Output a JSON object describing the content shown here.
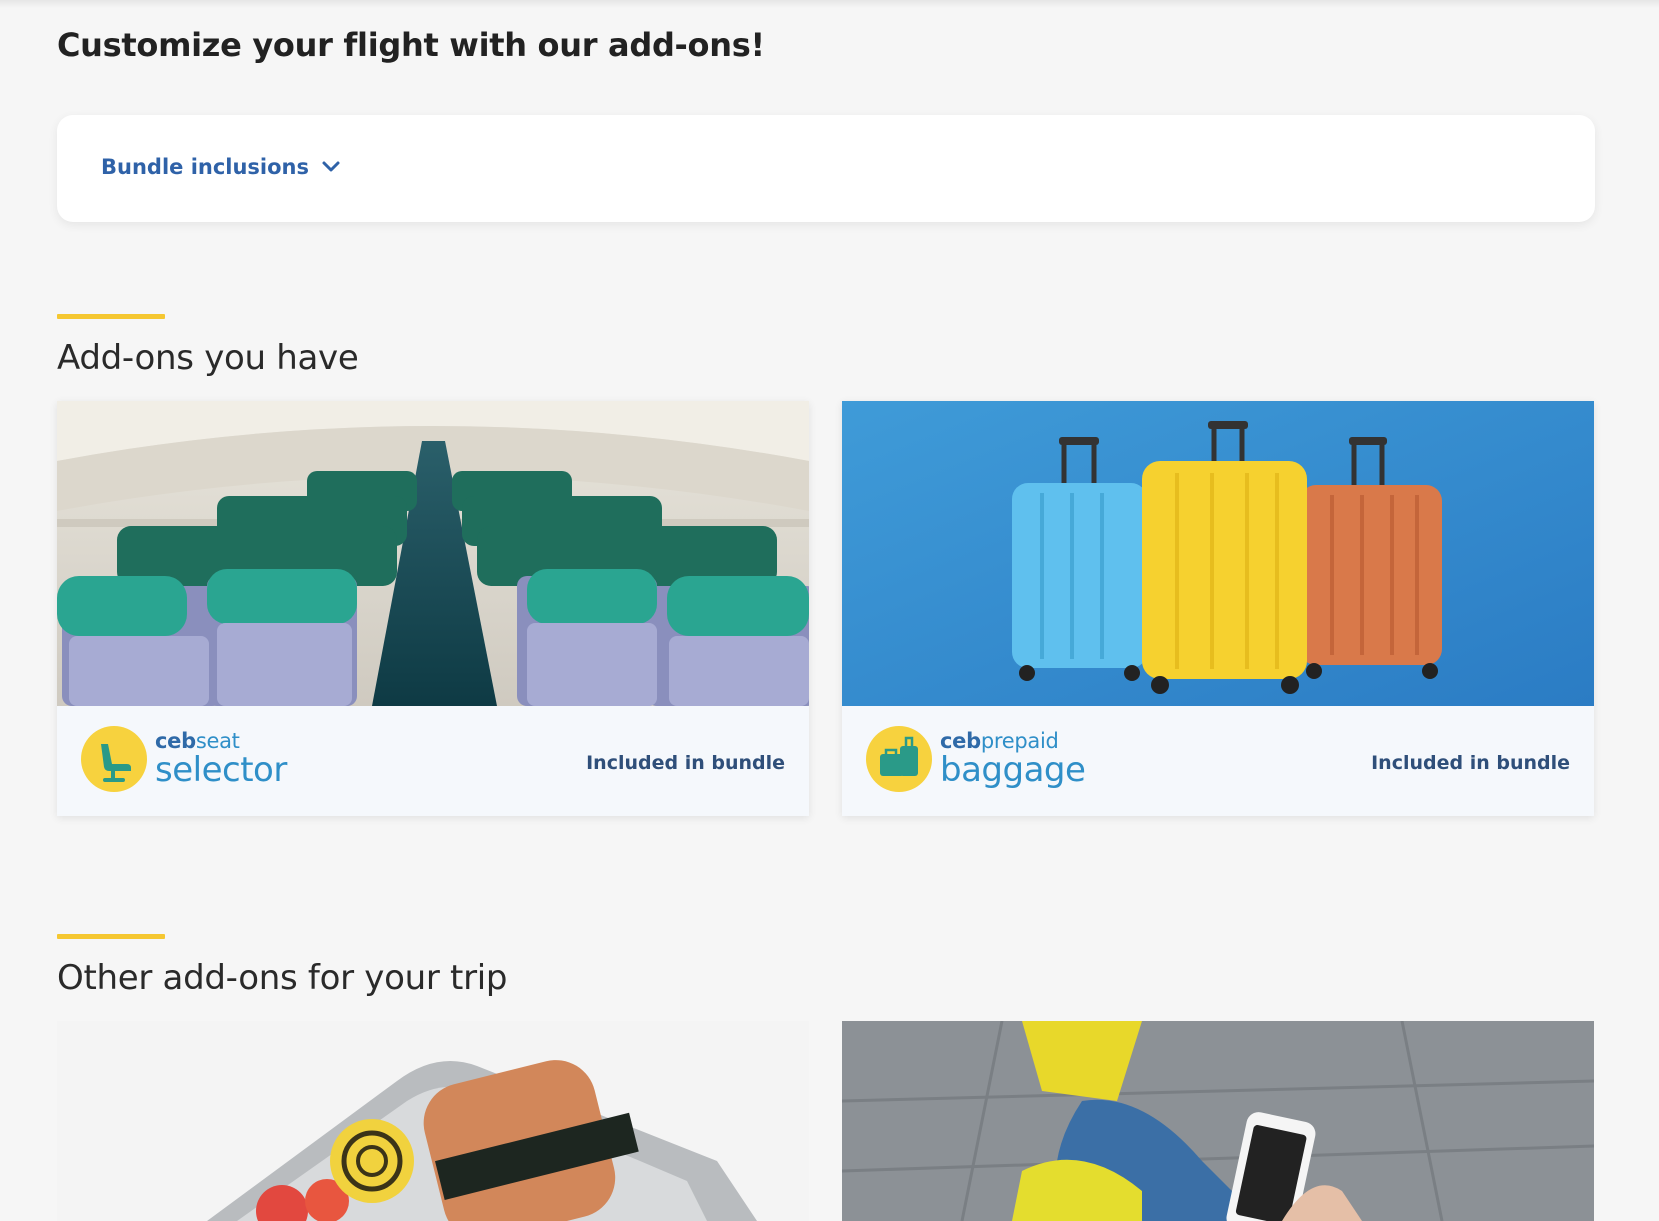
{
  "header": {
    "title": "Customize your flight with our add-ons!"
  },
  "bundle": {
    "toggle_label": "Bundle inclusions",
    "icon": "chevron-down-icon"
  },
  "sections": {
    "have": {
      "heading": "Add-ons you have",
      "cards": [
        {
          "brand_small_bold": "ceb",
          "brand_small": "seat",
          "brand_big": "selector",
          "status": "Included in bundle",
          "image": "airplane-cabin-seats",
          "icon": "seat-icon"
        },
        {
          "brand_small_bold": "ceb",
          "brand_small": "prepaid",
          "brand_big": "baggage",
          "status": "Included in bundle",
          "image": "luggage-suitcases",
          "icon": "luggage-icon"
        }
      ]
    },
    "other": {
      "heading": "Other add-ons for your trip",
      "cards": [
        {
          "image": "in-flight-meal"
        },
        {
          "image": "traveler-with-phone"
        }
      ]
    }
  },
  "colors": {
    "accent": "#f5c731",
    "link": "#2f62a8",
    "brand_blue": "#2f8fc8",
    "background": "#f6f6f6"
  }
}
